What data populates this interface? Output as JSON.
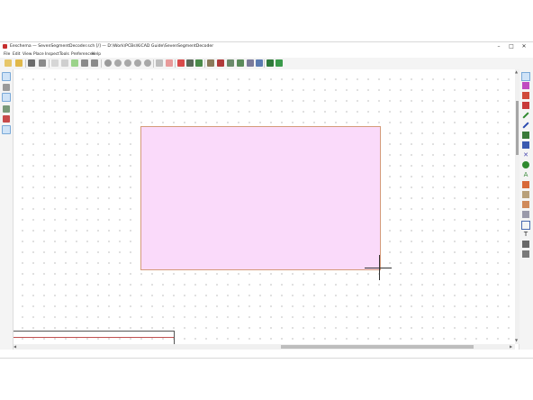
{
  "window": {
    "title": "Eeschema — SevenSegmentDecoder.sch [/] — D:\\Work\\PCBs\\KiCAD Guide\\SevenSegmentDecoder",
    "controls": {
      "minimize": "–",
      "maximize": "□",
      "close": "✕"
    }
  },
  "menubar": {
    "items": [
      "File",
      "Edit",
      "View",
      "Place",
      "Inspect",
      "Tools",
      "Preferences",
      "Help"
    ]
  },
  "colors": {
    "sheet_fill": "#fadafa",
    "sheet_border": "#d49a7a",
    "grid_dot": "#b8b8b8",
    "toolbar_bg": "#f4f4f4"
  },
  "toolbar": {
    "icons": [
      "new-schematic-icon",
      "open-icon",
      "save-icon",
      "page-settings-icon",
      "print-icon",
      "paste-icon",
      "undo-icon",
      "redo-icon",
      "find-icon",
      "find-replace-icon",
      "refresh-icon",
      "zoom-in-icon",
      "zoom-out-icon",
      "zoom-fit-icon",
      "zoom-selection-icon",
      "navigate-hierarchy-icon",
      "leave-sheet-icon",
      "symbol-editor-icon",
      "symbol-browser-icon",
      "annotate-icon",
      "erc-icon",
      "netlist-icon",
      "assign-footprints-icon",
      "bom-icon",
      "pcbnew-icon",
      "back-annotate-icon"
    ]
  },
  "left_toolbar": {
    "icons": [
      "grid-toggle-icon",
      "units-inch-icon",
      "units-mm-icon",
      "cursor-shape-icon",
      "hidden-pins-icon",
      "orthogonal-wires-icon"
    ]
  },
  "right_toolbar": {
    "icons": [
      "select-icon",
      "highlight-net-icon",
      "add-symbol-icon",
      "add-power-icon",
      "add-wire-icon",
      "add-bus-icon",
      "wire-bus-entry-icon",
      "bus-bus-entry-icon",
      "no-connect-icon",
      "junction-icon",
      "net-label-icon",
      "global-label-icon",
      "hierarchical-label-icon",
      "hierarchical-sheet-icon",
      "import-sheet-pin-icon",
      "add-sheet-pin-icon",
      "add-graphic-line-icon",
      "add-text-icon",
      "add-image-icon",
      "delete-icon"
    ]
  },
  "canvas": {
    "tool": "hierarchical-sheet",
    "state": "drawing sheet"
  }
}
